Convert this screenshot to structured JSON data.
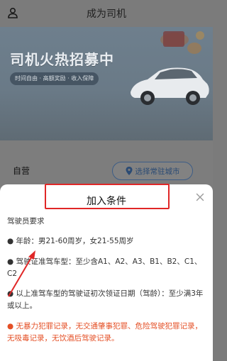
{
  "topbar": {
    "title": "成为司机",
    "user_icon": "user-icon"
  },
  "banner": {
    "title": "司机火热招募中",
    "subtitle": "时间自由 · 高额奖励 · 收入保障",
    "image": "car-illustration"
  },
  "filter": {
    "type_label": "自营",
    "city_button": "选择常驻城市",
    "city_icon": "location-pin-icon"
  },
  "sheet": {
    "title": "加入条件",
    "close_icon": "close-icon",
    "section_title": "驾驶员要求",
    "items": [
      "● 年龄：男21-60周岁，女21-55周岁",
      "● 驾驶证准驾车型：至少含A1、A2、A3、B1、B2、C1、C2",
      "● 以上准驾车型的驾驶证初次领证日期（驾龄）：至少满3年或以上。",
      "● 无暴力犯罪记录，无交通肇事犯罪、危险驾驶犯罪记录，无吸毒记录，无饮酒后驾驶记录。"
    ]
  },
  "colors": {
    "overlay": "#7b7b7b",
    "accent_blue": "#2b4b74",
    "highlight_red": "#e02727",
    "warning_orange": "#e44f25"
  }
}
